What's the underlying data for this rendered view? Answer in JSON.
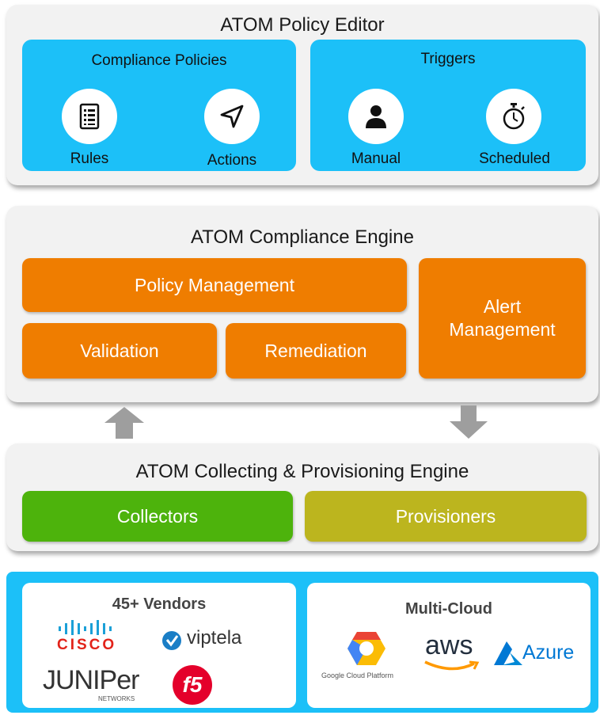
{
  "policy_editor": {
    "title": "ATOM Policy Editor",
    "compliance_policies": {
      "title": "Compliance Policies",
      "rules_label": "Rules",
      "actions_label": "Actions"
    },
    "triggers": {
      "title": "Triggers",
      "manual_label": "Manual",
      "scheduled_label": "Scheduled"
    }
  },
  "compliance_engine": {
    "title": "ATOM Compliance Engine",
    "policy_management": "Policy Management",
    "validation": "Validation",
    "remediation": "Remediation",
    "alert_management_line1": "Alert",
    "alert_management_line2": "Management"
  },
  "provisioning_engine": {
    "title": "ATOM Collecting & Provisioning Engine",
    "collectors": "Collectors",
    "provisioners": "Provisioners"
  },
  "vendors": {
    "title": "45+ Vendors",
    "cisco": "CISCO",
    "viptela": "viptela",
    "juniper": "JUNIPer",
    "juniper_sub": "NETWORKS",
    "f5": "f5"
  },
  "multicloud": {
    "title": "Multi-Cloud",
    "google": "Google Cloud Platform",
    "aws": "aws",
    "azure": "Azure"
  },
  "colors": {
    "blue": "#1cc0f8",
    "orange": "#ef7d00",
    "green": "#4db30c",
    "olive": "#bcb51e",
    "panel": "#f2f2f2",
    "arrow": "#9e9e9e"
  },
  "icons": [
    "checklist-icon",
    "send-arrow-icon",
    "person-icon",
    "stopwatch-icon",
    "arrow-up-icon",
    "arrow-down-icon"
  ]
}
